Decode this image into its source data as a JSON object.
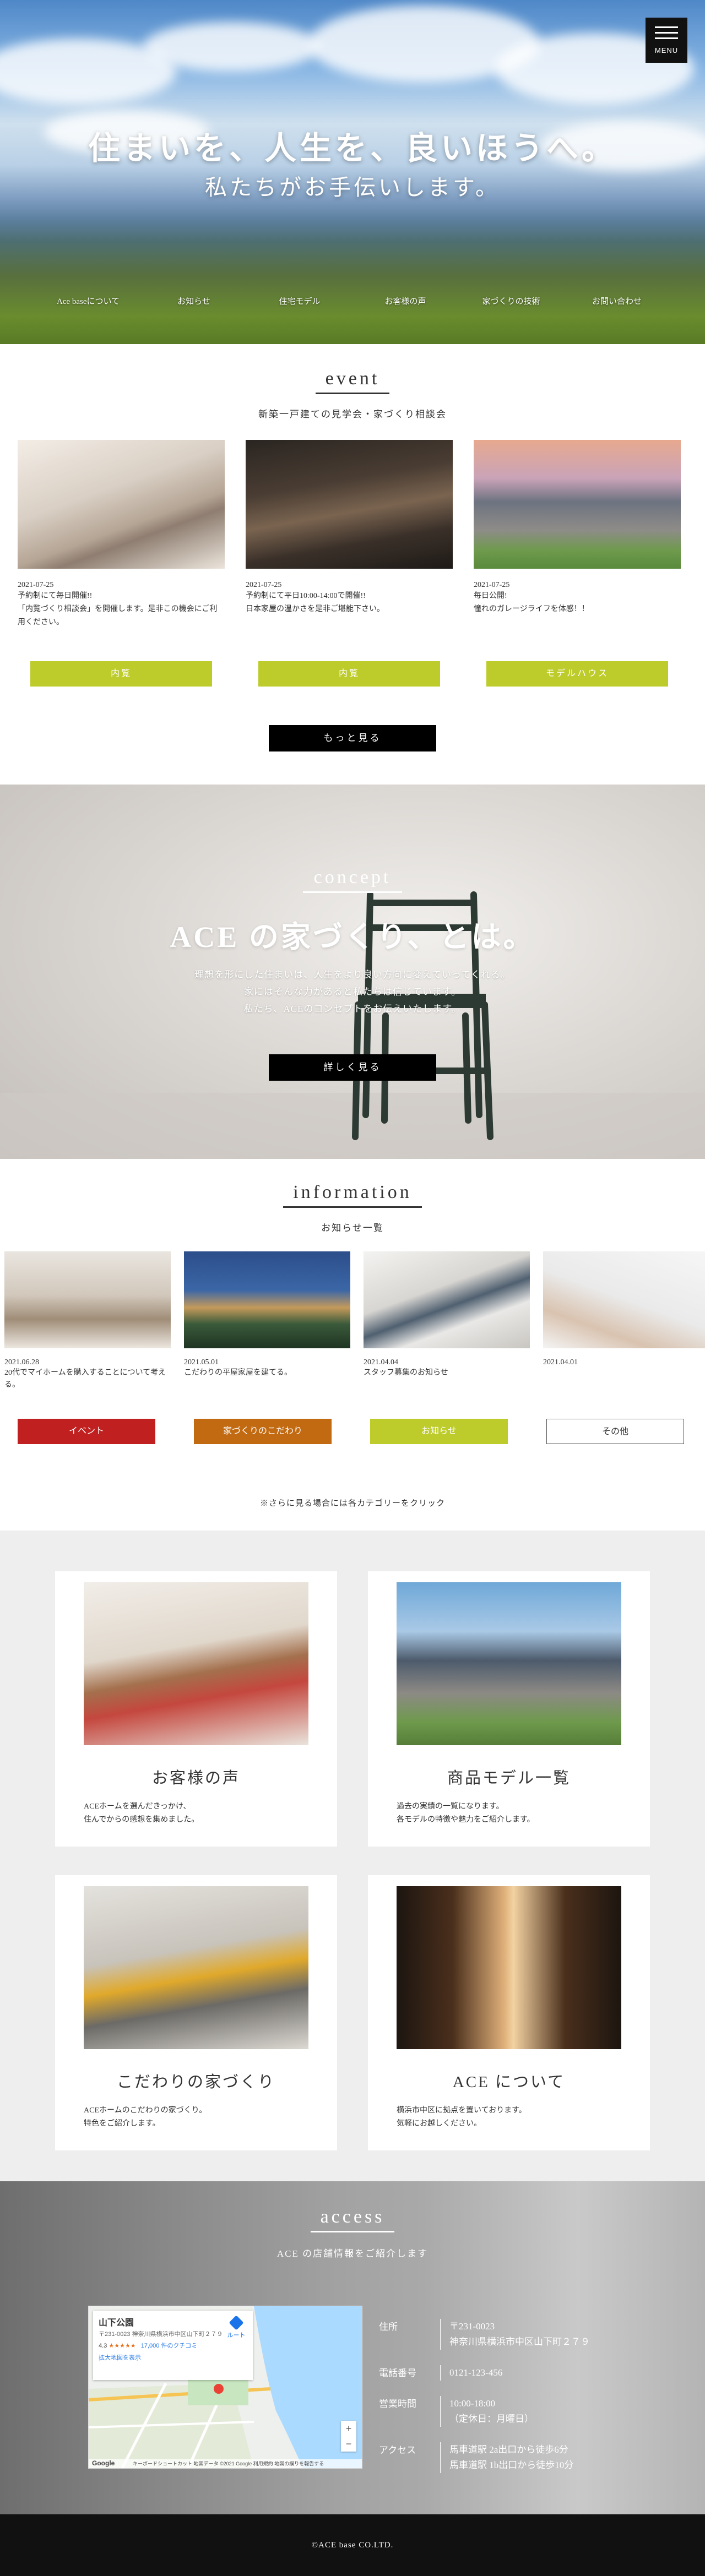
{
  "header": {
    "menu_label": "MENU",
    "hero_title": "住まいを、人生を、良いほうへ。",
    "hero_subtitle": "私たちがお手伝いします。",
    "nav": [
      "Ace baseについて",
      "お知らせ",
      "住宅モデル",
      "お客様の声",
      "家づくりの技術",
      "お問い合わせ"
    ]
  },
  "event": {
    "title": "event",
    "subtitle": "新築一戸建ての見学会・家づくり相談会",
    "items": [
      {
        "date": "2021-07-25",
        "desc": "予約制にて毎日開催!!\n「内覧づくり相談会」を開催します。是非この機会にご利用ください。",
        "button": "内覧"
      },
      {
        "date": "2021-07-25",
        "desc": "予約制にて平日10:00-14:00で開催!!\n日本家屋の温かさを是非ご堪能下さい。",
        "button": "内覧"
      },
      {
        "date": "2021-07-25",
        "desc": "毎日公開!\n憧れのガレージライフを体感！！",
        "button": "モデルハウス"
      }
    ],
    "more": "もっと見る"
  },
  "concept": {
    "title": "concept",
    "heading": "ACE の家づくり、とは。",
    "body": [
      "理想を形にした住まいは、人生をより良い方向に変えていってくれる。",
      "家にはそんな力があると私たちは信じています。",
      "私たち、ACEのコンセプトをお伝えいたします。"
    ],
    "button": "詳しく見る"
  },
  "information": {
    "title": "information",
    "subtitle": "お知らせ一覧",
    "items": [
      {
        "date": "2021.06.28",
        "desc": "20代でマイホームを購入することについて考える。"
      },
      {
        "date": "2021.05.01",
        "desc": "こだわりの平屋家屋を建てる。"
      },
      {
        "date": "2021.04.04",
        "desc": "スタッフ募集のお知らせ"
      },
      {
        "date": "2021.04.01",
        "desc": ""
      }
    ],
    "categories": [
      {
        "label": "イベント",
        "color": "#c0201f"
      },
      {
        "label": "家づくりのこだわり",
        "color": "#c16a12"
      },
      {
        "label": "お知らせ",
        "color": "#bdcc2b"
      },
      {
        "label": "その他",
        "color": "#ffffff"
      }
    ],
    "note": "※さらに見る場合には各カテゴリーをクリック"
  },
  "cards": [
    {
      "title": "お客様の声",
      "desc": "ACEホームを選んだきっかけ、\n住んでからの感想を集めました。"
    },
    {
      "title": "商品モデル一覧",
      "desc": "過去の実績の一覧になります。\n各モデルの特徴や魅力をご紹介します。"
    },
    {
      "title": "こだわりの家づくり",
      "desc": "ACEホームのこだわりの家づくり。\n特色をご紹介します。"
    },
    {
      "title": "ACE について",
      "desc": "横浜市中区に拠点を置いております。\n気軽にお越しください。"
    }
  ],
  "access": {
    "title": "access",
    "subtitle": "ACE の店舗情報をご紹介します",
    "map": {
      "place": "山下公園",
      "address": "〒231-0023 神奈川県横浜市中区山下町２７９",
      "rating": "4.3",
      "stars": "★★★★★",
      "reviews": "17,000 件のクチコミ",
      "route": "ルート",
      "larger_map": "拡大地図を表示",
      "google": "Google",
      "footer": "キーボードショートカット 地図データ ©2021 Google 利用規約 地図の誤りを報告する",
      "zoom_in": "+",
      "zoom_out": "−"
    },
    "rows": [
      {
        "k": "住所",
        "v": "〒231-0023\n神奈川県横浜市中区山下町２７９"
      },
      {
        "k": "電話番号",
        "v": "0121-123-456"
      },
      {
        "k": "営業時間",
        "v": "10:00-18:00\n（定休日：月曜日）"
      },
      {
        "k": "アクセス",
        "v": "馬車道駅 2a出口から徒歩6分\n馬車道駅 1b出口から徒歩10分"
      }
    ]
  },
  "footer": {
    "copyright": "©ACE base CO.LTD."
  }
}
